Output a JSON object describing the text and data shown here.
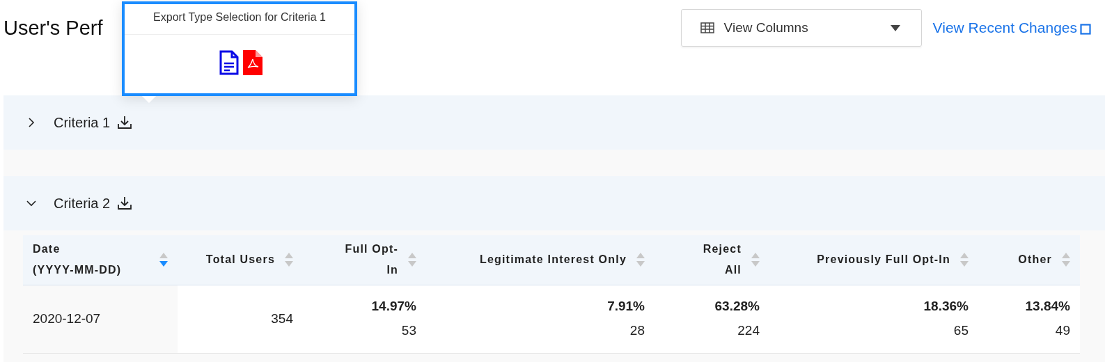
{
  "page_title": "User's Perf",
  "popover": {
    "title": "Export Type Selection for Criteria 1"
  },
  "view_columns": {
    "label": "View Columns"
  },
  "recent_changes_link": "View Recent Changes",
  "sections": [
    {
      "label": "Criteria 1",
      "expanded": false
    },
    {
      "label": "Criteria 2",
      "expanded": true,
      "table": {
        "columns": [
          {
            "label": "Date\n(YYYY-MM-DD)",
            "sorted_descending": true
          },
          {
            "label": "Total Users",
            "sorted_descending": false
          },
          {
            "label": "Full Opt-\nIn",
            "sorted_descending": false
          },
          {
            "label": "Legitimate Interest Only",
            "sorted_descending": false
          },
          {
            "label": "Reject\nAll",
            "sorted_descending": false
          },
          {
            "label": "Previously Full Opt-In",
            "sorted_descending": false
          },
          {
            "label": "Other",
            "sorted_descending": false
          }
        ],
        "rows": [
          {
            "cells": [
              {
                "kind": "text",
                "value": "2020-12-07"
              },
              {
                "kind": "text",
                "value": "354"
              },
              {
                "kind": "share",
                "percent": "14.97%",
                "count": "53"
              },
              {
                "kind": "share",
                "percent": "7.91%",
                "count": "28"
              },
              {
                "kind": "share",
                "percent": "63.28%",
                "count": "224"
              },
              {
                "kind": "share",
                "percent": "18.36%",
                "count": "65"
              },
              {
                "kind": "share",
                "percent": "13.84%",
                "count": "49"
              }
            ]
          }
        ]
      }
    }
  ]
}
